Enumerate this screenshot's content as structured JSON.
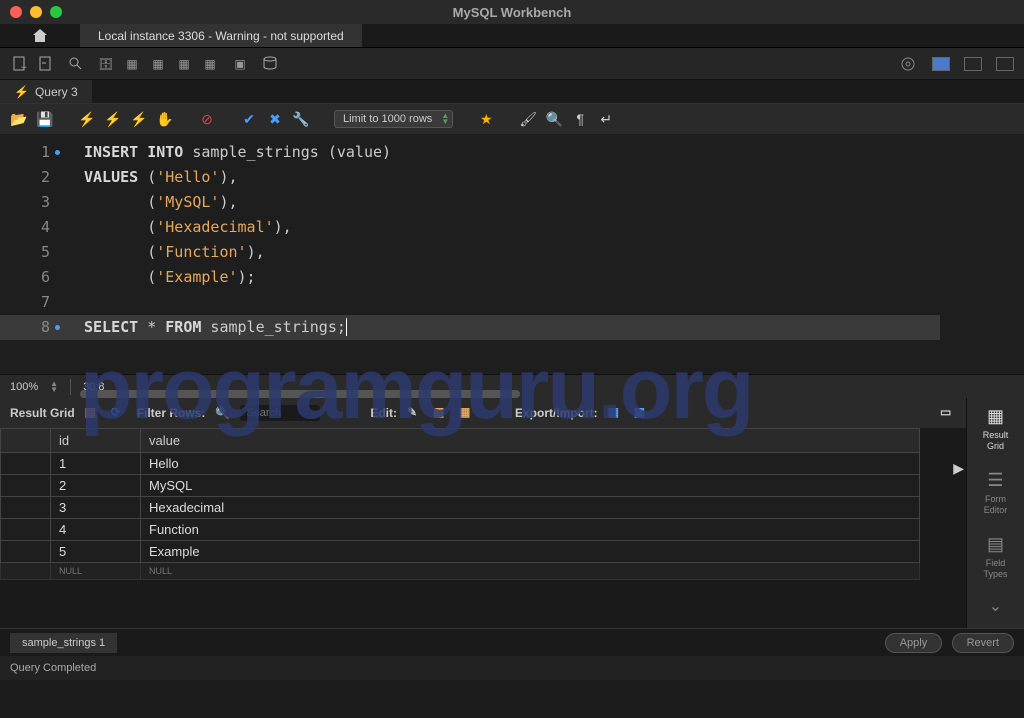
{
  "app_title": "MySQL Workbench",
  "conn_tab": "Local instance 3306 - Warning - not supported",
  "query_tab": "Query 3",
  "limit": "Limit to 1000 rows",
  "zoom": "100%",
  "cursor_pos": "30:8",
  "code": {
    "lines": [
      {
        "n": "1",
        "dot": true,
        "tokens": [
          [
            "kw",
            "INSERT"
          ],
          [
            "punct",
            " "
          ],
          [
            "kw",
            "INTO"
          ],
          [
            "punct",
            " sample_strings ("
          ],
          [
            "punct",
            "value"
          ],
          [
            "punct",
            ")"
          ]
        ]
      },
      {
        "n": "2",
        "dot": false,
        "tokens": [
          [
            "kw",
            "VALUES"
          ],
          [
            "punct",
            " ("
          ],
          [
            "str",
            "'Hello'"
          ],
          [
            "punct",
            "),"
          ]
        ]
      },
      {
        "n": "3",
        "dot": false,
        "tokens": [
          [
            "punct",
            "       ("
          ],
          [
            "str",
            "'MySQL'"
          ],
          [
            "punct",
            "),"
          ]
        ]
      },
      {
        "n": "4",
        "dot": false,
        "tokens": [
          [
            "punct",
            "       ("
          ],
          [
            "str",
            "'Hexadecimal'"
          ],
          [
            "punct",
            "),"
          ]
        ]
      },
      {
        "n": "5",
        "dot": false,
        "tokens": [
          [
            "punct",
            "       ("
          ],
          [
            "str",
            "'Function'"
          ],
          [
            "punct",
            "),"
          ]
        ]
      },
      {
        "n": "6",
        "dot": false,
        "tokens": [
          [
            "punct",
            "       ("
          ],
          [
            "str",
            "'Example'"
          ],
          [
            "punct",
            ");"
          ]
        ]
      },
      {
        "n": "7",
        "dot": false,
        "tokens": []
      },
      {
        "n": "8",
        "dot": true,
        "hl": true,
        "tokens": [
          [
            "kw",
            "SELECT"
          ],
          [
            "punct",
            " * "
          ],
          [
            "kw",
            "FROM"
          ],
          [
            "punct",
            " sample_strings;"
          ]
        ]
      }
    ]
  },
  "result_toolbar": {
    "label": "Result Grid",
    "filter": "Filter Rows:",
    "search_ph": "Search",
    "edit": "Edit:",
    "export": "Export/Import:"
  },
  "columns": [
    "id",
    "value"
  ],
  "rows": [
    {
      "id": "1",
      "value": "Hello"
    },
    {
      "id": "2",
      "value": "MySQL"
    },
    {
      "id": "3",
      "value": "Hexadecimal"
    },
    {
      "id": "4",
      "value": "Function"
    },
    {
      "id": "5",
      "value": "Example"
    }
  ],
  "null_label": "NULL",
  "side": {
    "result": "Result\nGrid",
    "form": "Form\nEditor",
    "field": "Field\nTypes"
  },
  "result_tab": "sample_strings 1",
  "apply": "Apply",
  "revert": "Revert",
  "status": "Query Completed",
  "watermark": "programguru.org"
}
